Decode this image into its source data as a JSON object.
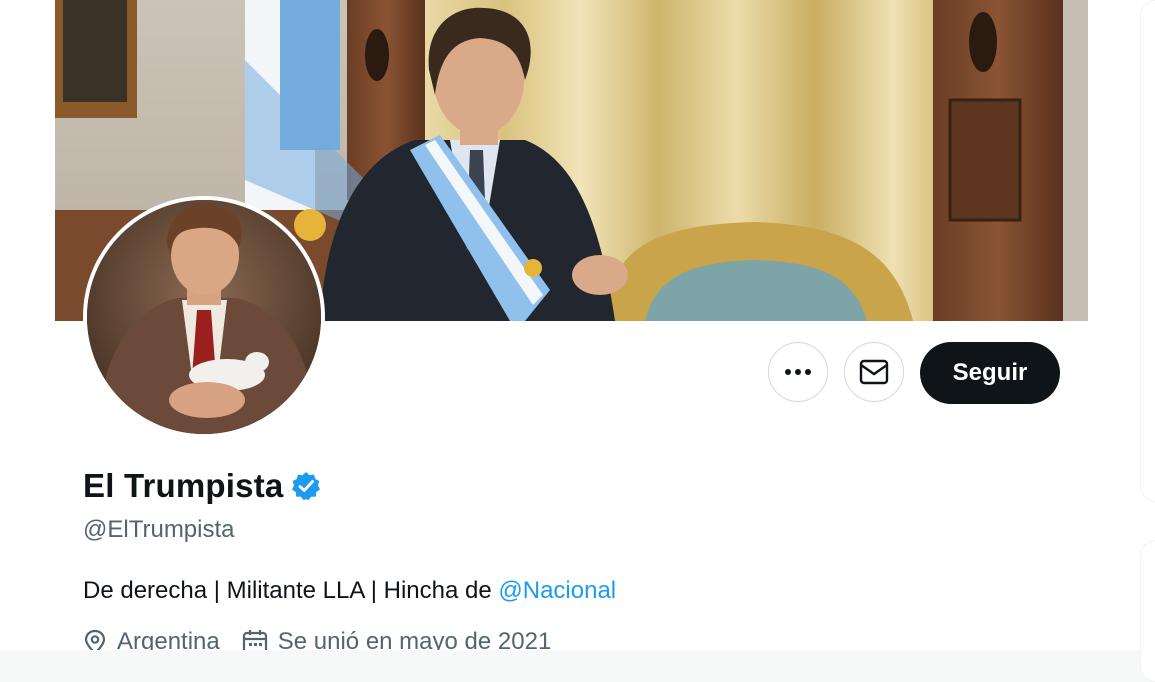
{
  "profile": {
    "display_name": "El Trumpista",
    "handle": "@ElTrumpista",
    "verified": true,
    "bio_text": "De derecha | Militante LLA | Hincha de ",
    "bio_mention": "@Nacional",
    "location": "Argentina",
    "joined": "Se unió en mayo de 2021"
  },
  "actions": {
    "more_icon": "more-horizontal-icon",
    "message_icon": "envelope-icon",
    "follow_label": "Seguir"
  },
  "icons": {
    "location": "map-pin-icon",
    "calendar": "calendar-icon",
    "verified": "verified-badge-icon"
  },
  "colors": {
    "accent": "#1d9bf0",
    "text_primary": "#0f1419",
    "text_secondary": "#536471",
    "follow_button_bg": "#0f1419"
  }
}
